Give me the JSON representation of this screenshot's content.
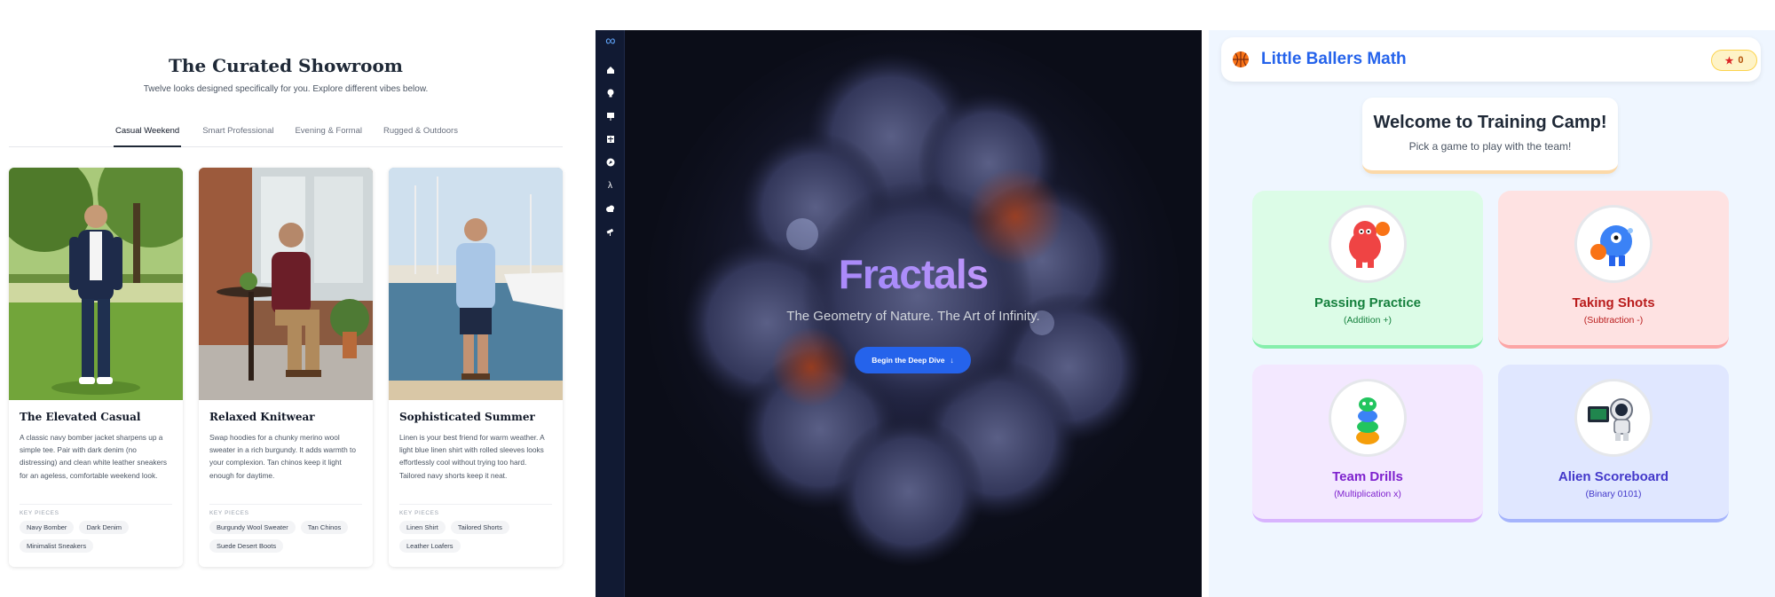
{
  "showroom": {
    "title": "The Curated Showroom",
    "subtitle": "Twelve looks designed specifically for you. Explore different vibes below.",
    "tabs": [
      "Casual Weekend",
      "Smart Professional",
      "Evening & Formal",
      "Rugged & Outdoors"
    ],
    "active_tab": "Casual Weekend",
    "key_pieces_label": "KEY PIECES",
    "cards": [
      {
        "title": "The Elevated Casual",
        "description": "A classic navy bomber jacket sharpens up a simple tee. Pair with dark denim (no distressing) and clean white leather sneakers for an ageless, comfortable weekend look.",
        "tags": [
          "Navy Bomber",
          "Dark Denim",
          "Minimalist Sneakers"
        ]
      },
      {
        "title": "Relaxed Knitwear",
        "description": "Swap hoodies for a chunky merino wool sweater in a rich burgundy. It adds warmth to your complexion. Tan chinos keep it light enough for daytime.",
        "tags": [
          "Burgundy Wool Sweater",
          "Tan Chinos",
          "Suede Desert Boots"
        ]
      },
      {
        "title": "Sophisticated Summer",
        "description": "Linen is your best friend for warm weather. A light blue linen shirt with rolled sleeves looks effortlessly cool without trying too hard. Tailored navy shorts keep it neat.",
        "tags": [
          "Linen Shirt",
          "Tailored Shorts",
          "Leather Loafers"
        ]
      }
    ]
  },
  "fractals": {
    "logo_icon": "infinity-icon",
    "nav_icons": [
      "home-icon",
      "lightbulb-icon",
      "presentation-icon",
      "grid-icon",
      "compass-icon",
      "lambda-icon",
      "cloud-icon",
      "telescope-icon"
    ],
    "title": "Fractals",
    "subtitle": "The Geometry of Nature. The Art of Infinity.",
    "cta_label": "Begin the Deep Dive",
    "cta_icon": "arrow-down-icon"
  },
  "math": {
    "app_title": "Little Ballers Math",
    "logo_icon": "basketball-icon",
    "score_icon": "star-icon",
    "score": "0",
    "welcome_title": "Welcome to Training Camp!",
    "welcome_subtitle": "Pick a game to play with the team!",
    "games": [
      {
        "name": "Passing Practice",
        "op": "(Addition +)",
        "bg": "#dcfce7",
        "accent": "#15803d",
        "border": "#86efac"
      },
      {
        "name": "Taking Shots",
        "op": "(Subtraction -)",
        "bg": "#fee2e2",
        "accent": "#b91c1c",
        "border": "#fca5a5"
      },
      {
        "name": "Team Drills",
        "op": "(Multiplication x)",
        "bg": "#f3e8ff",
        "accent": "#7e22ce",
        "border": "#d8b4fe"
      },
      {
        "name": "Alien Scoreboard",
        "op": "(Binary 0101)",
        "bg": "#e0e7ff",
        "accent": "#4338ca",
        "border": "#a5b4fc"
      }
    ]
  },
  "colors": {
    "brand_blue": "#2563eb",
    "fractal_bg": "#0b0d18",
    "showroom_text": "#1f2937"
  }
}
